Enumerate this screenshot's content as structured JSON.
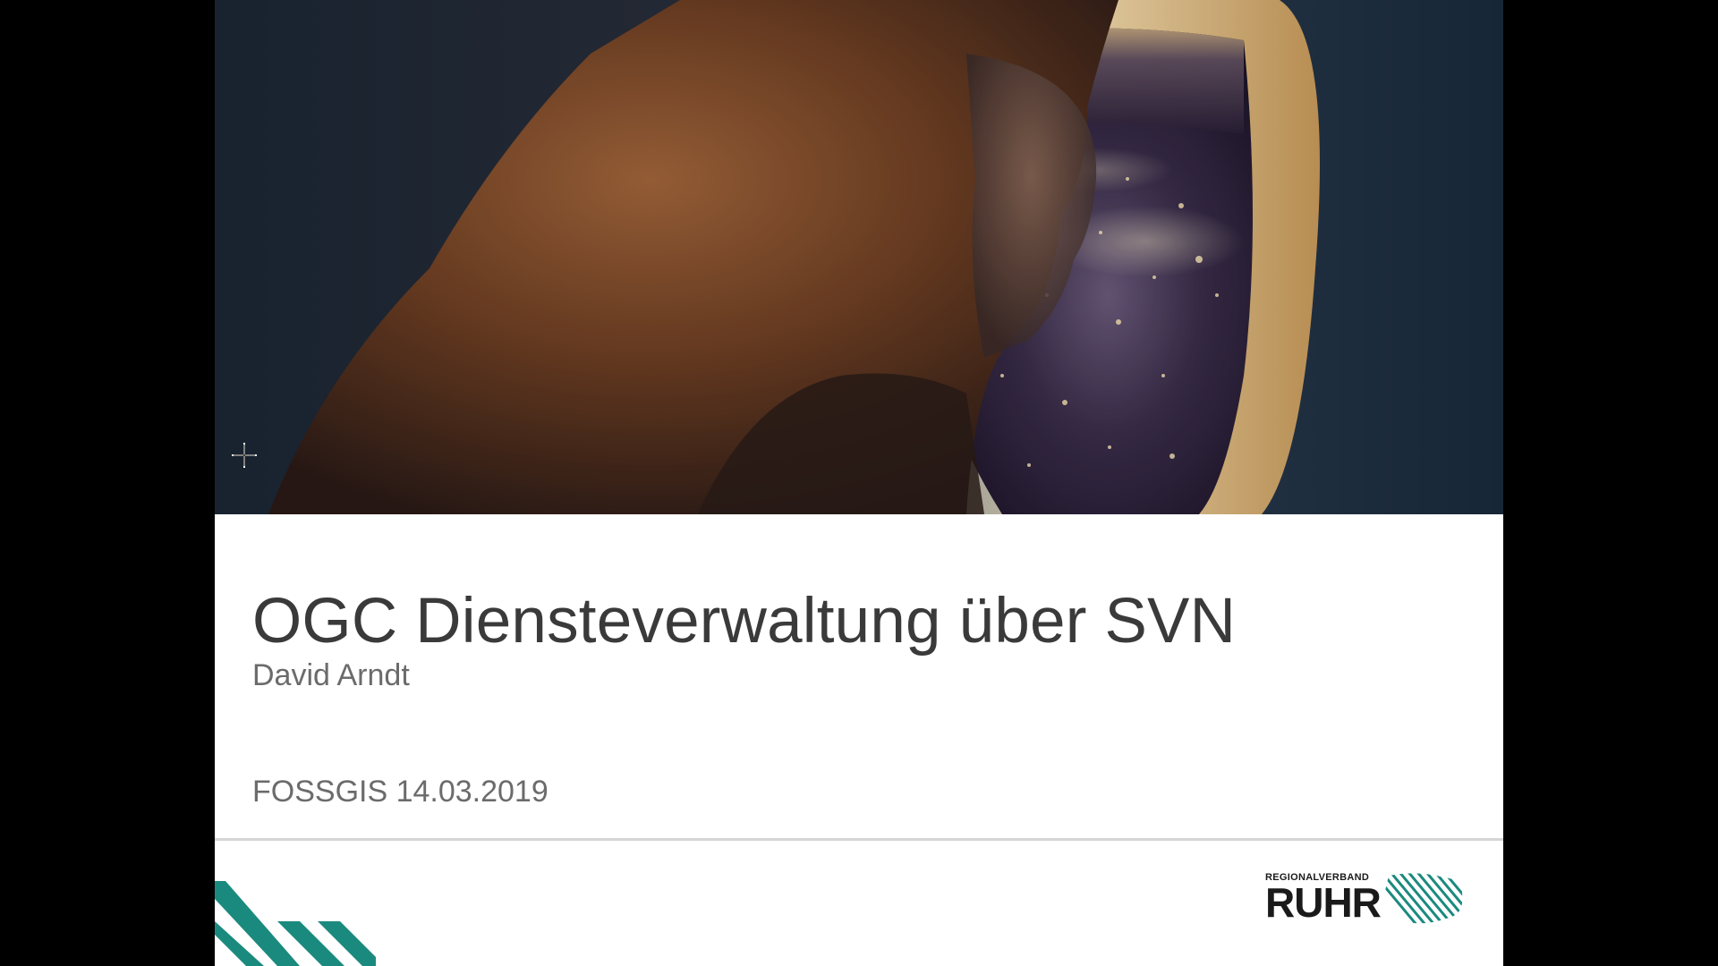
{
  "slide": {
    "title": "OGC Diensteverwaltung über SVN",
    "author": "David Arndt",
    "event_line": "FOSSGIS 14.03.2019"
  },
  "hero_image": {
    "alt": "Woman looking out of an airplane window at city lights at night"
  },
  "logo": {
    "small_text": "REGIONALVERBAND",
    "big_text": "RUHR",
    "mark_icon": "diagonal-stripes-icon"
  },
  "colors": {
    "letterbox": "#000000",
    "slide_background": "#ffffff",
    "title_text": "#3a3a3a",
    "subtitle_text": "#6b6b6b",
    "accent_teal": "#1b8a7e"
  },
  "cursor_icon": "crosshair-move-icon"
}
